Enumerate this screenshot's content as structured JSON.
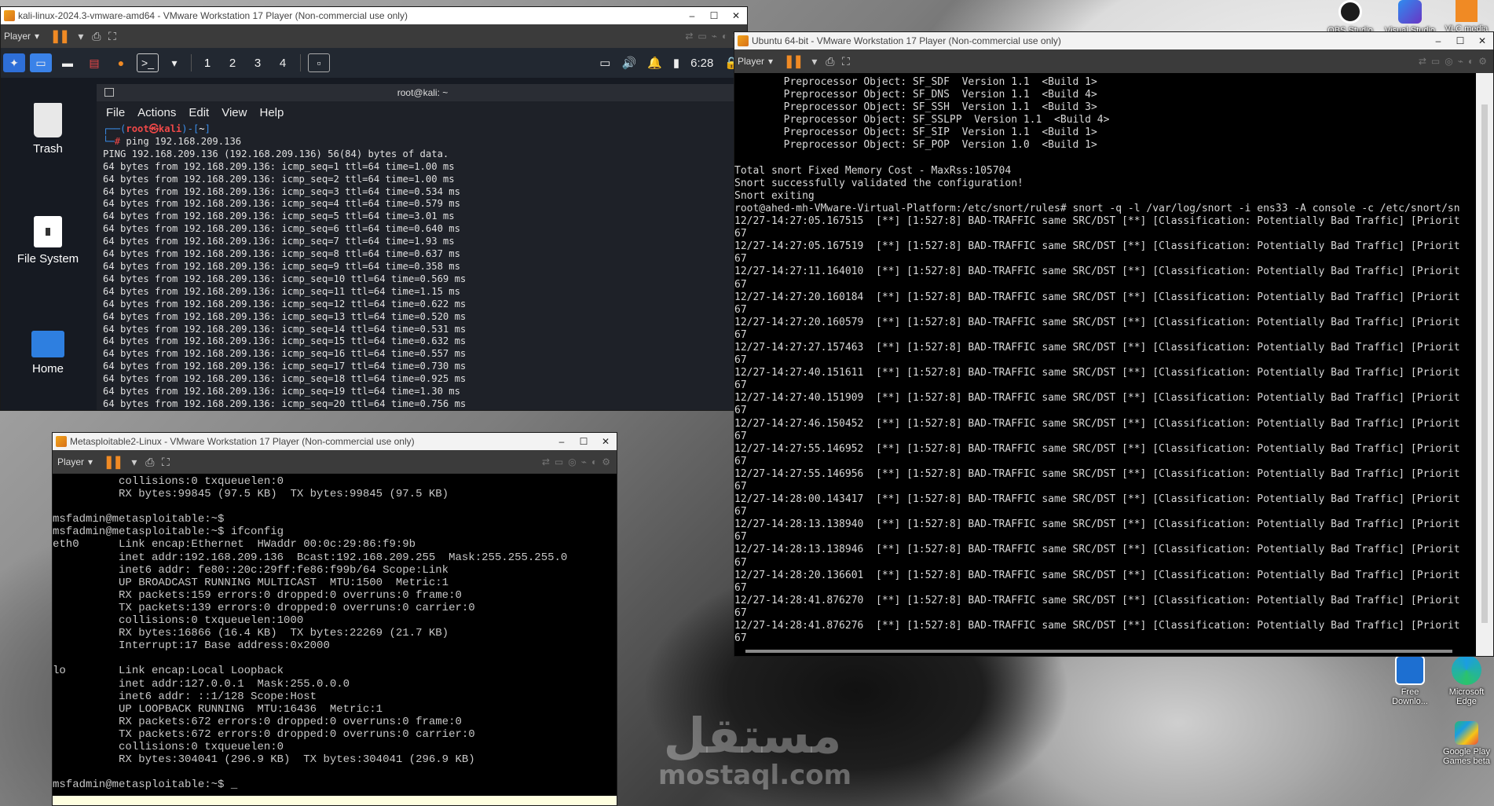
{
  "desktop": {
    "watermark": {
      "arabic": "مستقل",
      "latin": "mostaql.com"
    },
    "icons_right": [
      {
        "label": "OBS Studio",
        "color": "#1c1c1c"
      },
      {
        "label": "Visual Studio",
        "color": "#6a35c4"
      },
      {
        "label": "VLC media",
        "color": "#f08a24"
      },
      {
        "label": "Free Downlo...",
        "color": "#1d6fd1"
      },
      {
        "label": "Microsoft Edge",
        "color": "#1b9de2"
      },
      {
        "label": "Google Play Games beta",
        "color": "#2bb673"
      }
    ]
  },
  "kali": {
    "title": "kali-linux-2024.3-vmware-amd64 - VMware Workstation 17 Player (Non-commercial use only)",
    "player_label": "Player",
    "workspaces": [
      "1",
      "2",
      "3",
      "4"
    ],
    "clock": "6:28",
    "desktop_icons": [
      "Trash",
      "File System",
      "Home"
    ],
    "terminal": {
      "title": "root@kali: ~",
      "menu": [
        "File",
        "Actions",
        "Edit",
        "View",
        "Help"
      ],
      "prompt_top": "┌──(root㉿kali)-[~]",
      "prompt_user": "root",
      "prompt_host": "kali",
      "command": "ping 192.168.209.136",
      "output": "PING 192.168.209.136 (192.168.209.136) 56(84) bytes of data.\n64 bytes from 192.168.209.136: icmp_seq=1 ttl=64 time=1.00 ms\n64 bytes from 192.168.209.136: icmp_seq=2 ttl=64 time=1.00 ms\n64 bytes from 192.168.209.136: icmp_seq=3 ttl=64 time=0.534 ms\n64 bytes from 192.168.209.136: icmp_seq=4 ttl=64 time=0.579 ms\n64 bytes from 192.168.209.136: icmp_seq=5 ttl=64 time=3.01 ms\n64 bytes from 192.168.209.136: icmp_seq=6 ttl=64 time=0.640 ms\n64 bytes from 192.168.209.136: icmp_seq=7 ttl=64 time=1.93 ms\n64 bytes from 192.168.209.136: icmp_seq=8 ttl=64 time=0.637 ms\n64 bytes from 192.168.209.136: icmp_seq=9 ttl=64 time=0.358 ms\n64 bytes from 192.168.209.136: icmp_seq=10 ttl=64 time=0.569 ms\n64 bytes from 192.168.209.136: icmp_seq=11 ttl=64 time=1.15 ms\n64 bytes from 192.168.209.136: icmp_seq=12 ttl=64 time=0.622 ms\n64 bytes from 192.168.209.136: icmp_seq=13 ttl=64 time=0.520 ms\n64 bytes from 192.168.209.136: icmp_seq=14 ttl=64 time=0.531 ms\n64 bytes from 192.168.209.136: icmp_seq=15 ttl=64 time=0.632 ms\n64 bytes from 192.168.209.136: icmp_seq=16 ttl=64 time=0.557 ms\n64 bytes from 192.168.209.136: icmp_seq=17 ttl=64 time=0.730 ms\n64 bytes from 192.168.209.136: icmp_seq=18 ttl=64 time=0.925 ms\n64 bytes from 192.168.209.136: icmp_seq=19 ttl=64 time=1.30 ms\n64 bytes from 192.168.209.136: icmp_seq=20 ttl=64 time=0.756 ms"
    }
  },
  "ubuntu": {
    "title": "Ubuntu 64-bit - VMware Workstation 17 Player (Non-commercial use only)",
    "player_label": "Player",
    "console": "        Preprocessor Object: SF_SDF  Version 1.1  <Build 1>\n        Preprocessor Object: SF_DNS  Version 1.1  <Build 4>\n        Preprocessor Object: SF_SSH  Version 1.1  <Build 3>\n        Preprocessor Object: SF_SSLPP  Version 1.1  <Build 4>\n        Preprocessor Object: SF_SIP  Version 1.1  <Build 1>\n        Preprocessor Object: SF_POP  Version 1.0  <Build 1>\n\nTotal snort Fixed Memory Cost - MaxRss:105704\nSnort successfully validated the configuration!\nSnort exiting\nroot@ahed-mh-VMware-Virtual-Platform:/etc/snort/rules# snort -q -l /var/log/snort -i ens33 -A console -c /etc/snort/sn\n12/27-14:27:05.167515  [**] [1:527:8] BAD-TRAFFIC same SRC/DST [**] [Classification: Potentially Bad Traffic] [Priorit\n67\n12/27-14:27:05.167519  [**] [1:527:8] BAD-TRAFFIC same SRC/DST [**] [Classification: Potentially Bad Traffic] [Priorit\n67\n12/27-14:27:11.164010  [**] [1:527:8] BAD-TRAFFIC same SRC/DST [**] [Classification: Potentially Bad Traffic] [Priorit\n67\n12/27-14:27:20.160184  [**] [1:527:8] BAD-TRAFFIC same SRC/DST [**] [Classification: Potentially Bad Traffic] [Priorit\n67\n12/27-14:27:20.160579  [**] [1:527:8] BAD-TRAFFIC same SRC/DST [**] [Classification: Potentially Bad Traffic] [Priorit\n67\n12/27-14:27:27.157463  [**] [1:527:8] BAD-TRAFFIC same SRC/DST [**] [Classification: Potentially Bad Traffic] [Priorit\n67\n12/27-14:27:40.151611  [**] [1:527:8] BAD-TRAFFIC same SRC/DST [**] [Classification: Potentially Bad Traffic] [Priorit\n67\n12/27-14:27:40.151909  [**] [1:527:8] BAD-TRAFFIC same SRC/DST [**] [Classification: Potentially Bad Traffic] [Priorit\n67\n12/27-14:27:46.150452  [**] [1:527:8] BAD-TRAFFIC same SRC/DST [**] [Classification: Potentially Bad Traffic] [Priorit\n67\n12/27-14:27:55.146952  [**] [1:527:8] BAD-TRAFFIC same SRC/DST [**] [Classification: Potentially Bad Traffic] [Priorit\n67\n12/27-14:27:55.146956  [**] [1:527:8] BAD-TRAFFIC same SRC/DST [**] [Classification: Potentially Bad Traffic] [Priorit\n67\n12/27-14:28:00.143417  [**] [1:527:8] BAD-TRAFFIC same SRC/DST [**] [Classification: Potentially Bad Traffic] [Priorit\n67\n12/27-14:28:13.138940  [**] [1:527:8] BAD-TRAFFIC same SRC/DST [**] [Classification: Potentially Bad Traffic] [Priorit\n67\n12/27-14:28:13.138946  [**] [1:527:8] BAD-TRAFFIC same SRC/DST [**] [Classification: Potentially Bad Traffic] [Priorit\n67\n12/27-14:28:20.136601  [**] [1:527:8] BAD-TRAFFIC same SRC/DST [**] [Classification: Potentially Bad Traffic] [Priorit\n67\n12/27-14:28:41.876270  [**] [1:527:8] BAD-TRAFFIC same SRC/DST [**] [Classification: Potentially Bad Traffic] [Priorit\n67\n12/27-14:28:41.876276  [**] [1:527:8] BAD-TRAFFIC same SRC/DST [**] [Classification: Potentially Bad Traffic] [Priorit\n67"
  },
  "metasploitable": {
    "title": "Metasploitable2-Linux - VMware Workstation 17 Player (Non-commercial use only)",
    "player_label": "Player",
    "console": "          collisions:0 txqueuelen:0\n          RX bytes:99845 (97.5 KB)  TX bytes:99845 (97.5 KB)\n\nmsfadmin@metasploitable:~$\nmsfadmin@metasploitable:~$ ifconfig\neth0      Link encap:Ethernet  HWaddr 00:0c:29:86:f9:9b\n          inet addr:192.168.209.136  Bcast:192.168.209.255  Mask:255.255.255.0\n          inet6 addr: fe80::20c:29ff:fe86:f99b/64 Scope:Link\n          UP BROADCAST RUNNING MULTICAST  MTU:1500  Metric:1\n          RX packets:159 errors:0 dropped:0 overruns:0 frame:0\n          TX packets:139 errors:0 dropped:0 overruns:0 carrier:0\n          collisions:0 txqueuelen:1000\n          RX bytes:16866 (16.4 KB)  TX bytes:22269 (21.7 KB)\n          Interrupt:17 Base address:0x2000\n\nlo        Link encap:Local Loopback\n          inet addr:127.0.0.1  Mask:255.0.0.0\n          inet6 addr: ::1/128 Scope:Host\n          UP LOOPBACK RUNNING  MTU:16436  Metric:1\n          RX packets:672 errors:0 dropped:0 overruns:0 frame:0\n          TX packets:672 errors:0 dropped:0 overruns:0 carrier:0\n          collisions:0 txqueuelen:0\n          RX bytes:304041 (296.9 KB)  TX bytes:304041 (296.9 KB)\n\nmsfadmin@metasploitable:~$ _"
  }
}
